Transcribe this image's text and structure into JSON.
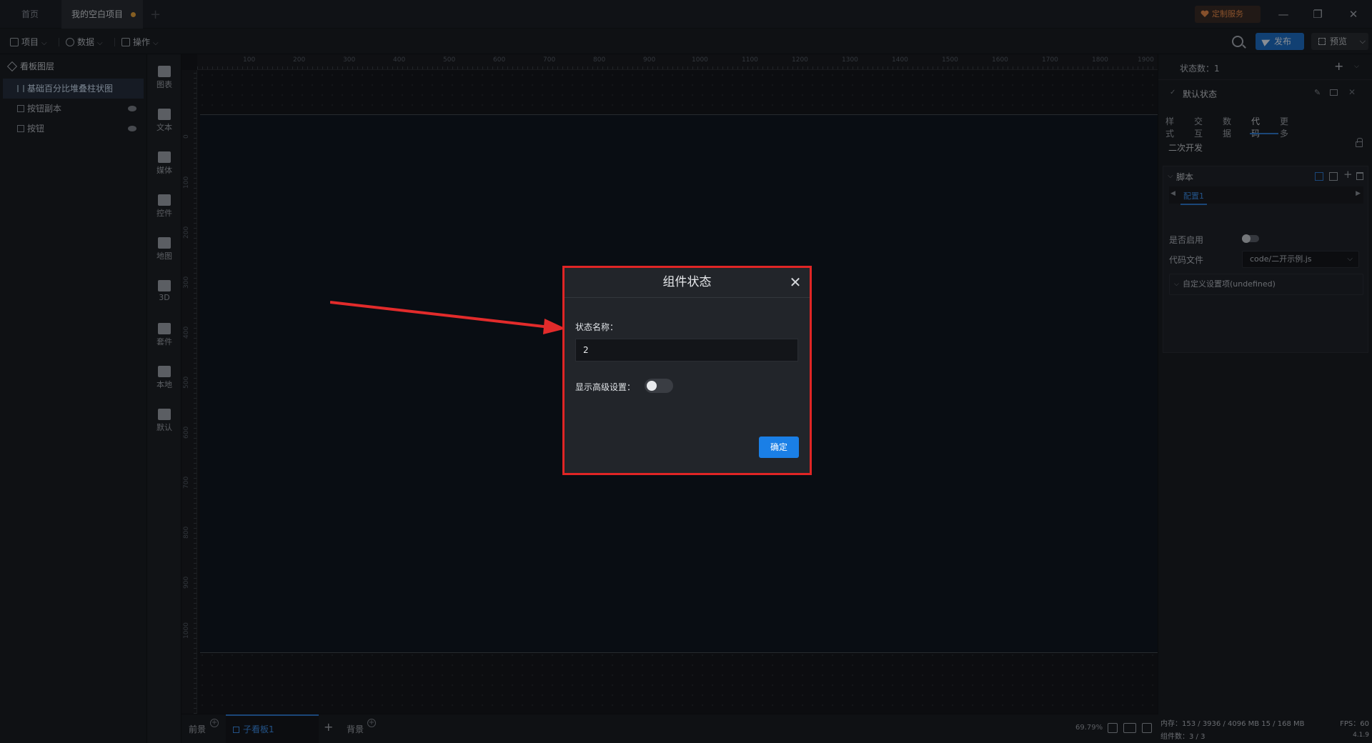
{
  "tabs": {
    "home": "首页",
    "project": "我的空白项目"
  },
  "custom_service": "定制服务",
  "toolbar": {
    "menus": [
      "项目",
      "数据",
      "操作"
    ],
    "publish": "发布",
    "preview": "预览"
  },
  "layers": {
    "title": "看板图层",
    "items": [
      "基础百分比堆叠柱状图",
      "按钮副本",
      "按钮"
    ]
  },
  "toolbox": [
    "图表",
    "文本",
    "媒体",
    "控件",
    "地图",
    "3D",
    "套件",
    "本地",
    "默认"
  ],
  "ruler": [
    "100",
    "200",
    "300",
    "400",
    "500",
    "600",
    "700",
    "800",
    "900",
    "1000",
    "1100",
    "1200",
    "1300",
    "1400",
    "1500",
    "1600",
    "1700",
    "1800",
    "1900"
  ],
  "ruler_left": [
    "0",
    "100",
    "200",
    "300",
    "400",
    "500",
    "600",
    "700",
    "800",
    "900",
    "1000"
  ],
  "bottom": {
    "front": "前景",
    "sub_board": "子看板1",
    "background": "背景",
    "zoom": "69.79%"
  },
  "right_panel": {
    "state_count": "状态数：1",
    "default_state": "默认状态",
    "tabs": [
      "样式",
      "交互",
      "数据",
      "代码",
      "更多"
    ],
    "active_tab": "代码",
    "secondary_dev": "二次开发",
    "script": "脚本",
    "config": "配置1",
    "enabled_label": "是否启用",
    "code_file_label": "代码文件",
    "code_file_value": "code/二开示例.js",
    "custom_settings": "自定义设置项(undefined)"
  },
  "footer": {
    "memory": "内存：153 / 3936 / 4096 MB  15 / 168 MB",
    "fps": "FPS：60",
    "components": "组件数：3 / 3",
    "version": "4.1.9"
  },
  "modal": {
    "title": "组件状态",
    "state_name_label": "状态名称：",
    "state_name_value": "2",
    "advanced_label": "显示高级设置：",
    "ok": "确定"
  },
  "colors": {
    "accent": "#1a7fe6",
    "highlight": "#e02525"
  }
}
